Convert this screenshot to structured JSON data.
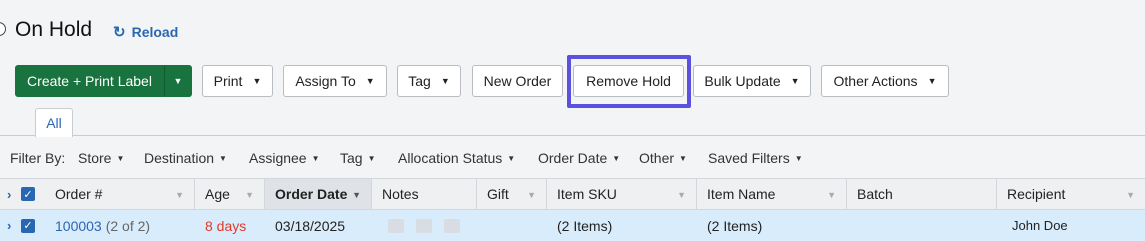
{
  "header": {
    "title": "On Hold",
    "reload_label": "Reload",
    "reload_icon": "reload-icon"
  },
  "toolbar": {
    "create_label": "Create + Print Label",
    "print_label": "Print",
    "assign_label": "Assign To",
    "tag_label": "Tag",
    "new_order_label": "New Order",
    "remove_hold_label": "Remove Hold",
    "bulk_update_label": "Bulk Update",
    "other_actions_label": "Other Actions"
  },
  "tabs": {
    "all_label": "All"
  },
  "filters": {
    "label": "Filter By:",
    "items": [
      "Store",
      "Destination",
      "Assignee",
      "Tag",
      "Allocation Status",
      "Order Date",
      "Other",
      "Saved Filters"
    ]
  },
  "grid": {
    "columns": [
      "Order #",
      "Age",
      "Order Date",
      "Notes",
      "Gift",
      "Item SKU",
      "Item Name",
      "Batch",
      "Recipient"
    ],
    "sorted_column": "Order Date",
    "rows": [
      {
        "order_number": "100003",
        "order_count": "(2 of 2)",
        "age": "8 days",
        "order_date": "03/18/2025",
        "item_sku": "(2 Items)",
        "item_name": "(2 Items)",
        "batch": "",
        "recipient": "John Doe"
      }
    ]
  },
  "colors": {
    "primary_green": "#18733e",
    "link_blue": "#2a67b1",
    "highlight_purple": "#5b50e0",
    "age_red": "#e2392b",
    "selected_row": "#d9ecfb"
  }
}
